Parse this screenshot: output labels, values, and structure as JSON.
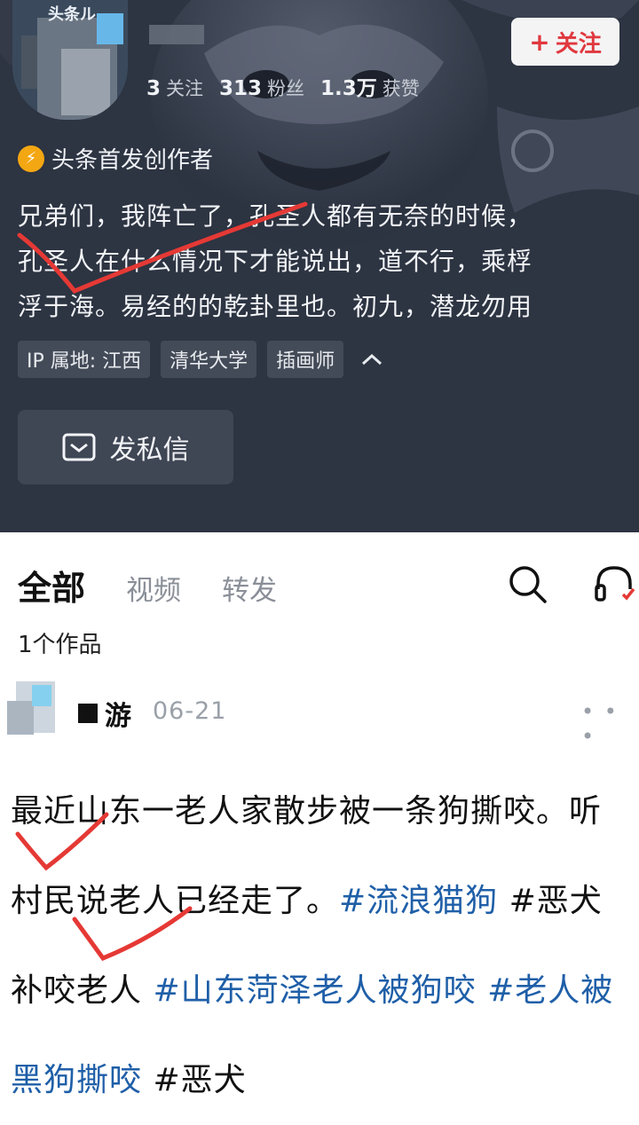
{
  "profile": {
    "avatar_tag": "头条ル",
    "follow_label": "关注",
    "stats": [
      {
        "num": "3",
        "label": "关注"
      },
      {
        "num": "313",
        "label": "粉丝"
      },
      {
        "num": "1.3万",
        "label": "获赞"
      }
    ],
    "creator_badge": "头条首发创作者",
    "bio": "兄弟们，我阵亡了，孔圣人都有无奈的时候，\n孔圣人在什么情况下才能说出，道不行，乘桴\n浮于海。易经的的乾卦里也。初九，潜龙勿用",
    "tags": [
      "IP 属地: 江西",
      "清华大学",
      "插画师"
    ],
    "message_label": "发私信"
  },
  "content": {
    "tabs": [
      {
        "label": "全部",
        "active": true
      },
      {
        "label": "视频",
        "active": false
      },
      {
        "label": "转发",
        "active": false
      }
    ],
    "works_count": "1个作品",
    "post": {
      "author": "游",
      "date": "06-21",
      "more": "• • •",
      "text_plain": "最近山东一老人家散步被一条狗撕咬。听村民说老人已经走了。",
      "hashtags": [
        "#流浪猫狗",
        "#恶犬补咬老人",
        "#山东菏泽老人被狗咬",
        "#老人被黑狗撕咬",
        "#恶犬"
      ]
    }
  },
  "colors": {
    "cover_bg": "#2d3442",
    "follow_text": "#e0383e",
    "hashtag": "#1f5fa8",
    "check_mark": "#e53935",
    "badge": "#f3a712"
  }
}
